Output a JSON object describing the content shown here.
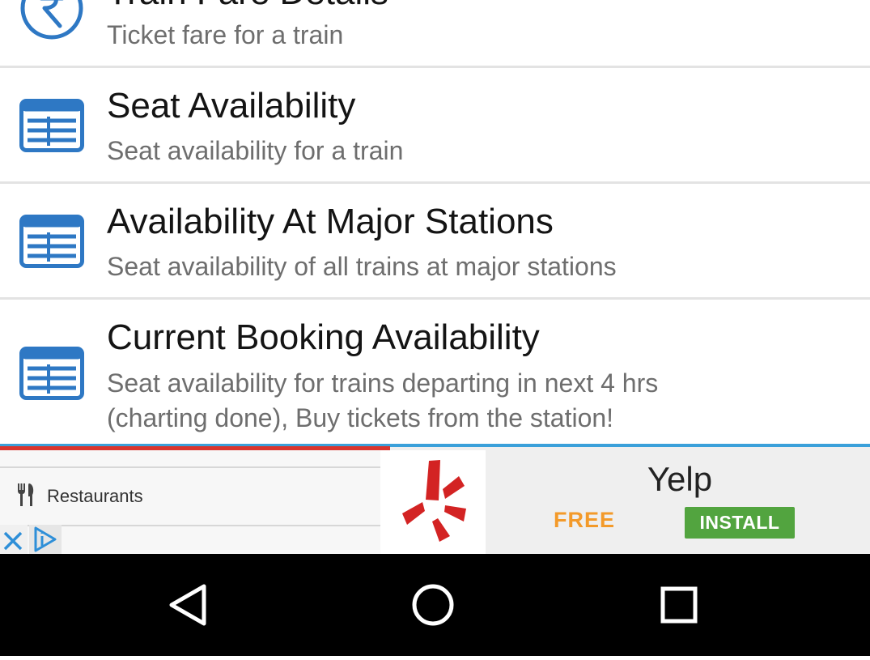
{
  "items": [
    {
      "title": "Train Fare Details",
      "subtitle": "Ticket fare for a train",
      "icon": "rupee-icon"
    },
    {
      "title": "Seat Availability",
      "subtitle": "Seat availability for a train",
      "icon": "seat-table-icon"
    },
    {
      "title": "Availability At Major Stations",
      "subtitle": "Seat availability of all trains at major stations",
      "icon": "seat-table-icon"
    },
    {
      "title": "Current Booking Availability",
      "subtitle_line1": "Seat availability for trains departing in next 4 hrs",
      "subtitle_line2": "(charting done), Buy tickets from the station!",
      "icon": "seat-table-icon"
    }
  ],
  "ad": {
    "category": "Restaurants",
    "app_name": "Yelp",
    "price": "FREE",
    "install_label": "INSTALL",
    "icons": [
      "fork-knife-icon",
      "yelp-logo",
      "close-icon",
      "adchoices-icon"
    ]
  },
  "navbar": {
    "icons": [
      "back-icon",
      "home-icon",
      "recents-icon"
    ]
  },
  "colors": {
    "icon_blue": "#2e78c4",
    "title_text": "#141414",
    "subtitle_text": "#6e6e6e",
    "divider": "#e3e3e3",
    "ad_blue_line": "#3aa0da",
    "ad_red_line": "#d8352f",
    "free_orange": "#f39a2a",
    "install_green": "#52a43f",
    "yelp_red": "#d32323"
  }
}
